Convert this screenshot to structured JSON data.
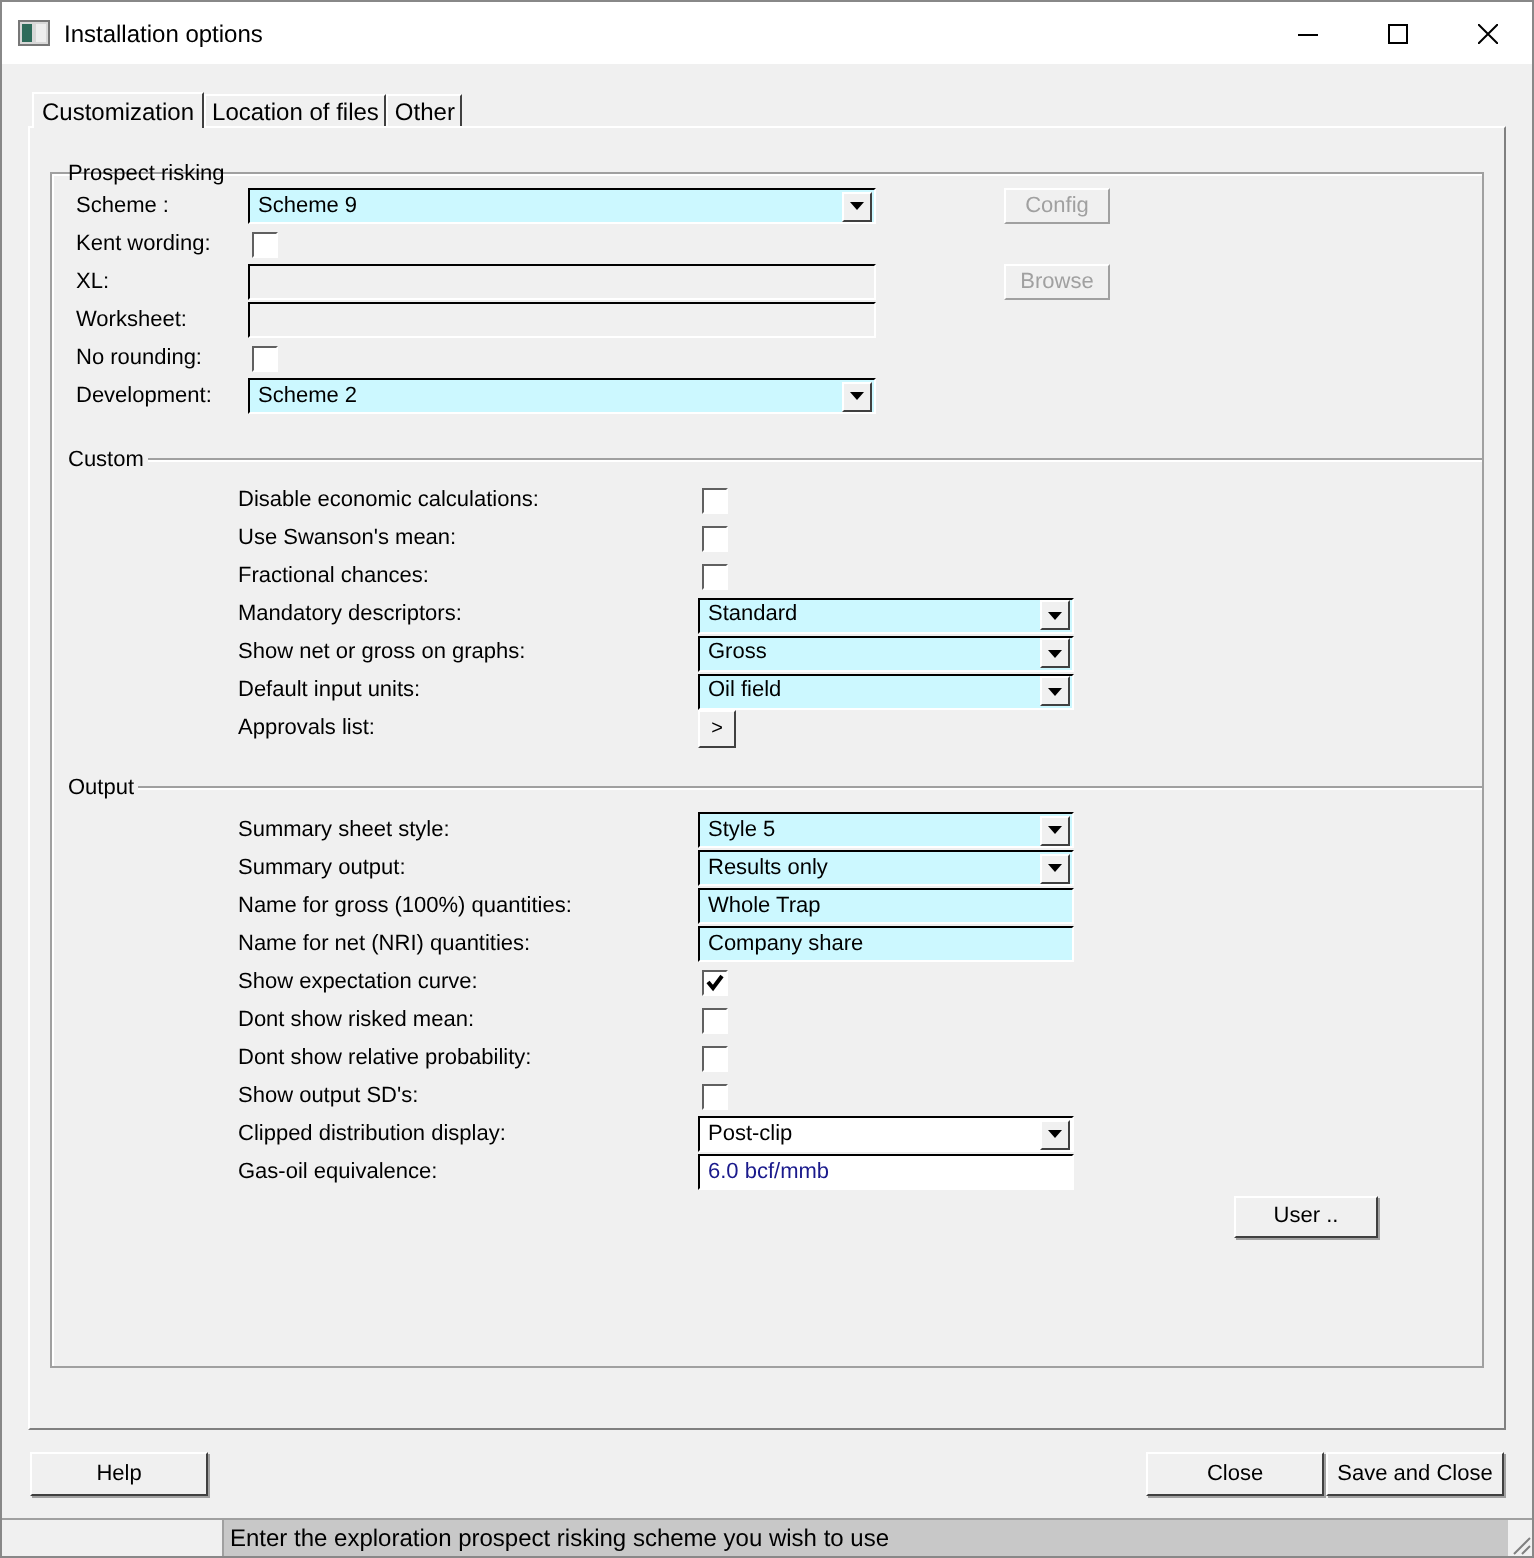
{
  "window": {
    "title": "Installation options"
  },
  "tabs": [
    {
      "label": "Customization",
      "selected": true
    },
    {
      "label": "Location of files",
      "selected": false
    },
    {
      "label": "Other",
      "selected": false
    }
  ],
  "prospect_risking": {
    "title": "Prospect risking",
    "rows": [
      {
        "kind": "dropdown",
        "label": "Scheme :",
        "value": "Scheme 9",
        "highlighted": true,
        "side_button": {
          "label": "Config",
          "disabled": true
        }
      },
      {
        "kind": "checkbox",
        "label": "Kent wording:",
        "checked": false
      },
      {
        "kind": "text",
        "label": "XL:",
        "disabled": true,
        "side_button": {
          "label": "Browse",
          "disabled": true
        }
      },
      {
        "kind": "text",
        "label": "Worksheet:",
        "disabled": true
      },
      {
        "kind": "checkbox",
        "label": "No rounding:",
        "checked": false
      },
      {
        "kind": "dropdown",
        "label": "Development:",
        "value": "Scheme 2",
        "highlighted": true
      }
    ]
  },
  "custom": {
    "title": "Custom",
    "rows": [
      {
        "kind": "checkbox",
        "label": "Disable economic calculations:",
        "checked": false
      },
      {
        "kind": "checkbox",
        "label": "Use Swanson's mean:",
        "checked": false
      },
      {
        "kind": "checkbox",
        "label": "Fractional chances:",
        "checked": false
      },
      {
        "kind": "dropdown",
        "label": "Mandatory descriptors:",
        "value": "Standard",
        "highlighted": true
      },
      {
        "kind": "dropdown",
        "label": "Show net or gross on graphs:",
        "value": "Gross",
        "highlighted": true
      },
      {
        "kind": "dropdown",
        "label": "Default input units:",
        "value": "Oil field",
        "highlighted": true
      },
      {
        "kind": "button",
        "label": "Approvals list:",
        "value": ">"
      }
    ]
  },
  "output": {
    "title": "Output",
    "rows": [
      {
        "kind": "dropdown",
        "label": "Summary sheet style:",
        "value": "Style 5",
        "highlighted": true
      },
      {
        "kind": "dropdown",
        "label": "Summary output:",
        "value": "Results only",
        "highlighted": true
      },
      {
        "kind": "text",
        "label": "Name for gross (100%) quantities:",
        "value": "Whole Trap",
        "highlighted": true
      },
      {
        "kind": "text",
        "label": "Name for net (NRI) quantities:",
        "value": "Company share",
        "highlighted": true
      },
      {
        "kind": "checkbox",
        "label": "Show expectation curve:",
        "checked": true
      },
      {
        "kind": "checkbox",
        "label": "Dont show risked mean:",
        "checked": false
      },
      {
        "kind": "checkbox",
        "label": "Dont show relative probability:",
        "checked": false
      },
      {
        "kind": "checkbox",
        "label": "Show output SD's:",
        "checked": false
      },
      {
        "kind": "dropdown",
        "label": "Clipped distribution display:",
        "value": "Post-clip",
        "highlighted": false
      },
      {
        "kind": "text",
        "label": "Gas-oil equivalence:",
        "value": "6.0 bcf/mmb",
        "highlighted": false
      }
    ],
    "button": "User .."
  },
  "footer_buttons": {
    "left": [
      "Help"
    ],
    "right": [
      "Close",
      "Save and Close"
    ]
  },
  "status_bar": {
    "message": "Enter the exploration prospect risking scheme you wish to use"
  }
}
